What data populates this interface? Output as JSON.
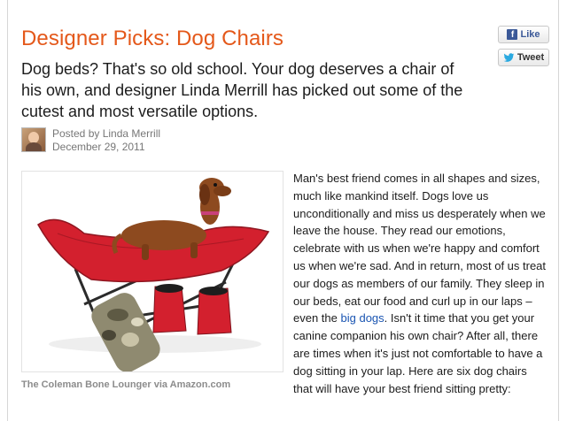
{
  "article": {
    "title": "Designer Picks: Dog Chairs",
    "dek": "Dog beds? That's so old school. Your dog deserves a chair of his own, and designer Linda Merrill has picked out some of the cutest and most versatile options.",
    "byline": {
      "author_line": "Posted by Linda Merrill",
      "date": "December 29, 2011"
    },
    "image_caption": "The Coleman Bone Lounger via Amazon.com",
    "body": {
      "part1": "Man's best friend comes in all shapes and sizes, much like mankind itself. Dogs love us unconditionally and miss us desperately when we leave the house. They read our emotions, celebrate with us when we're happy and comfort us when we're sad. And in return, most of us treat our dogs as members of our family. They sleep in our beds, eat our food and curl up in our laps – even the ",
      "link": "big dogs",
      "part2": ". Isn't it time that you get your canine companion his own chair? After all, there are times when it's just not comfortable to have a dog sitting in your lap. Here are six dog chairs that will have your best friend sitting pretty:"
    }
  },
  "social": {
    "like_label": "Like",
    "tweet_label": "Tweet",
    "facebook_glyph": "f"
  },
  "colors": {
    "title": "#e4581a",
    "link": "#1a55b2",
    "caption": "#8c8c8c"
  }
}
